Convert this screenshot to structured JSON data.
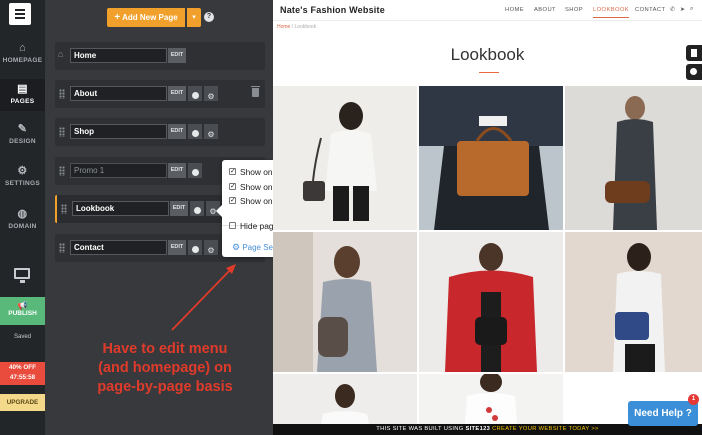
{
  "rail": {
    "items": [
      {
        "label": "HOMEPAGE",
        "icon": "home-icon",
        "glyph": "⌂"
      },
      {
        "label": "PAGES",
        "icon": "pages-icon",
        "glyph": "▤"
      },
      {
        "label": "DESIGN",
        "icon": "brush-icon",
        "glyph": "✎"
      },
      {
        "label": "SETTINGS",
        "icon": "gear-icon",
        "glyph": "⚙"
      },
      {
        "label": "DOMAIN",
        "icon": "globe-icon",
        "glyph": "◍"
      }
    ],
    "publish_label": "PUBLISH",
    "saved_label": "Saved",
    "promo_line1": "40% OFF",
    "promo_line2": "47:55:58",
    "upgrade_label": "UPGRADE"
  },
  "panel": {
    "add_button_label": "Add New Page",
    "help_glyph": "?",
    "edit_label": "EDIT",
    "pages": [
      {
        "name": "Home"
      },
      {
        "name": "About"
      },
      {
        "name": "Shop"
      },
      {
        "name": "Promo 1"
      },
      {
        "name": "Lookbook"
      },
      {
        "name": "Contact"
      }
    ]
  },
  "popover": {
    "show_on_menu": "Show on Menu",
    "show_on_homepage": "Show on Homepage",
    "show_on_footer": "Show on Footer",
    "hide_page": "Hide page from users",
    "page_settings": "Page Settings",
    "checked": {
      "menu": true,
      "homepage": true,
      "footer": true,
      "hide": false
    }
  },
  "annotation": {
    "line1": "Have to edit menu",
    "line2": "(and homepage) on",
    "line3": "page-by-page basis",
    "color": "#e03a2b"
  },
  "site": {
    "logo": "Nate's Fashion Website",
    "nav": [
      "HOME",
      "ABOUT",
      "SHOP",
      "LOOKBOOK",
      "CONTACT"
    ],
    "active_nav": "LOOKBOOK",
    "breadcrumb_home": "Home",
    "breadcrumb_sep": "/",
    "breadcrumb_current": "Lookbook",
    "page_title": "Lookbook",
    "banner_text": "THIS SITE WAS BUILT USING",
    "banner_brand": "SITE123",
    "banner_cta": "CREATE YOUR WEBSITE TODAY >>",
    "need_help": "Need Help ?",
    "help_badge": "1"
  },
  "colors": {
    "accent": "#f0a02b",
    "publish": "#58b97a",
    "promo": "#e94b3c",
    "upgrade": "#f5d98b",
    "link": "#4a90d9",
    "site_accent": "#e8693f",
    "help_button": "#3a8fd8"
  }
}
